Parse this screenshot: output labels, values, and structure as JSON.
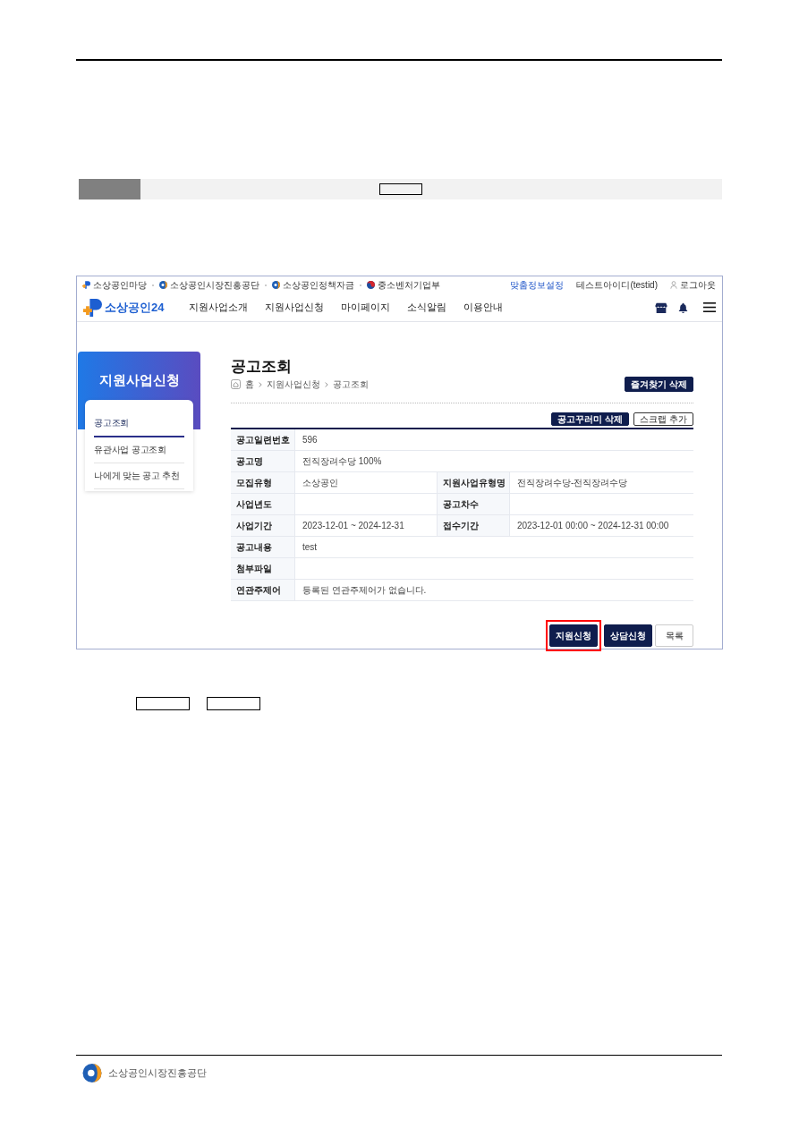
{
  "site": {
    "utility_links": [
      "소상공인마당",
      "소상공인시장진흥공단",
      "소상공인정책자금",
      "중소벤처기업부"
    ],
    "user_links": [
      {
        "label": "맞춤정보설정",
        "kind": "link"
      },
      {
        "label": "테스트아이디(testid)",
        "kind": "account"
      },
      {
        "label": "로그아웃",
        "kind": "logout"
      }
    ],
    "logo": "소상공인24",
    "nav": [
      "지원사업소개",
      "지원사업신청",
      "마이페이지",
      "소식알림",
      "이용안내"
    ]
  },
  "sidebar": {
    "title": "지원사업신청",
    "items": [
      {
        "label": "공고조회",
        "selected": true
      },
      {
        "label": "유관사업 공고조회",
        "selected": false
      },
      {
        "label": "나에게 맞는 공고 추천",
        "selected": false
      }
    ]
  },
  "main": {
    "title": "공고조회",
    "breadcrumb": [
      "홈",
      "지원사업신청",
      "공고조회"
    ],
    "favorite_button": "즐겨찾기 삭제",
    "actions": [
      {
        "label": "공고꾸러미 삭제",
        "kind": "primary"
      },
      {
        "label": "스크랩 추가",
        "kind": "outline"
      }
    ],
    "detail_table": {
      "rows": [
        {
          "fields": [
            {
              "label": "공고일련번호",
              "value": "596"
            }
          ]
        },
        {
          "fields": [
            {
              "label": "공고명",
              "value": "전직장려수당 100%"
            }
          ]
        },
        {
          "fields": [
            {
              "label": "모집유형",
              "value": "소상공인"
            },
            {
              "label": "지원사업유형명",
              "value": "전직장려수당-전직장려수당"
            }
          ]
        },
        {
          "fields": [
            {
              "label": "사업년도"
            },
            {
              "label": "공고차수"
            }
          ]
        },
        {
          "fields": [
            {
              "label": "사업기간",
              "value": "2023-12-01 ~ 2024-12-31"
            },
            {
              "label": "접수기간",
              "value": "2023-12-01 00:00 ~ 2024-12-31 00:00"
            }
          ]
        },
        {
          "fields": [
            {
              "label": "공고내용",
              "value": "test"
            }
          ]
        },
        {
          "fields": [
            {
              "label": "첨부파일"
            }
          ]
        },
        {
          "fields": [
            {
              "label": "연관주제어",
              "value": "등록된 연관주제어가 없습니다."
            }
          ]
        }
      ]
    },
    "buttons": [
      {
        "label": "지원신청",
        "kind": "primary",
        "highlighted": true
      },
      {
        "label": "상담신청",
        "kind": "primary",
        "highlighted": false
      },
      {
        "label": "목록",
        "kind": "outline",
        "highlighted": false
      }
    ]
  },
  "footer": {
    "organization": "소상공인시장진흥공단"
  }
}
